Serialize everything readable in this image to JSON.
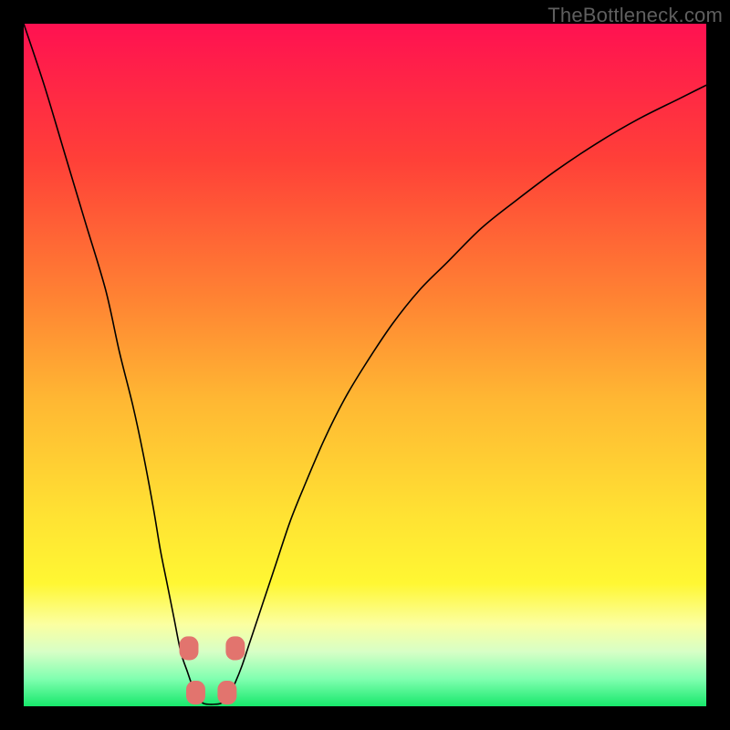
{
  "watermark": "TheBottleneck.com",
  "chart_data": {
    "type": "line",
    "title": "",
    "xlabel": "",
    "ylabel": "",
    "xlim": [
      0,
      100
    ],
    "ylim": [
      0,
      100
    ],
    "axes_visible": false,
    "grid": false,
    "background_gradient": {
      "type": "vertical",
      "stops": [
        {
          "pos": 0.0,
          "color": "#ff1151"
        },
        {
          "pos": 0.2,
          "color": "#ff4038"
        },
        {
          "pos": 0.4,
          "color": "#ff8233"
        },
        {
          "pos": 0.55,
          "color": "#ffb733"
        },
        {
          "pos": 0.72,
          "color": "#ffe233"
        },
        {
          "pos": 0.82,
          "color": "#fff733"
        },
        {
          "pos": 0.88,
          "color": "#fbffa1"
        },
        {
          "pos": 0.92,
          "color": "#d7ffc6"
        },
        {
          "pos": 0.96,
          "color": "#80ffb0"
        },
        {
          "pos": 1.0,
          "color": "#17e86b"
        }
      ]
    },
    "series": [
      {
        "name": "bottleneck-curve",
        "stroke": "#000000",
        "stroke_width": 1.6,
        "x": [
          0,
          3,
          6,
          9,
          12,
          14,
          16,
          17.5,
          19,
          20,
          21,
          22,
          23,
          24,
          24.7,
          25.4,
          26.2,
          27,
          28,
          29,
          30,
          31,
          32,
          33,
          34,
          35,
          37,
          39,
          41,
          44,
          47,
          50,
          54,
          58,
          62,
          67,
          72,
          78,
          84,
          90,
          96,
          100
        ],
        "y": [
          100,
          91,
          81,
          71,
          61,
          52,
          44,
          37,
          29,
          23,
          18,
          13,
          8,
          5,
          3,
          1.5,
          0.5,
          0.3,
          0.3,
          0.5,
          1.5,
          3.5,
          6,
          9,
          12,
          15,
          21,
          27,
          32,
          39,
          45,
          50,
          56,
          61,
          65,
          70,
          74,
          78.5,
          82.5,
          86,
          89,
          91
        ]
      }
    ],
    "markers": [
      {
        "shape": "rounded-square",
        "cx": 24.2,
        "cy": 8.5,
        "size": 2.8,
        "fill": "#e2746e"
      },
      {
        "shape": "rounded-square",
        "cx": 31.0,
        "cy": 8.5,
        "size": 2.8,
        "fill": "#e2746e"
      },
      {
        "shape": "rounded-square",
        "cx": 25.2,
        "cy": 2.0,
        "size": 2.8,
        "fill": "#e2746e"
      },
      {
        "shape": "rounded-square",
        "cx": 29.8,
        "cy": 2.0,
        "size": 2.8,
        "fill": "#e2746e"
      }
    ]
  }
}
